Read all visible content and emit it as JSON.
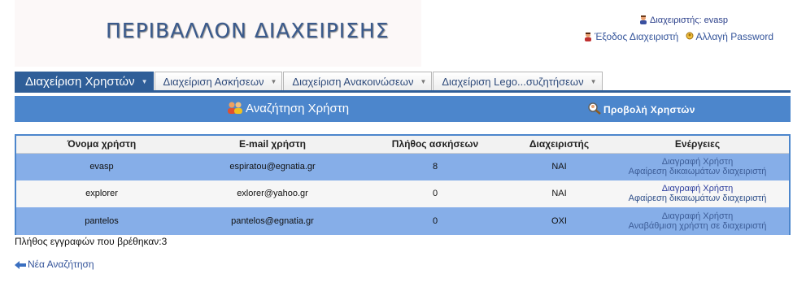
{
  "header": {
    "app_title": "ΠΕΡΙΒΑΛΛΟΝ ΔΙΑΧΕΙΡΙΣΗΣ",
    "admin_label": "Διαχειριστής:",
    "admin_name": "evasp",
    "logout_label": "Έξοδος Διαχειριστή",
    "change_password_label": "Αλλαγή Password"
  },
  "tabs": [
    {
      "label": "Διαχείριση Χρηστών",
      "active": true
    },
    {
      "label": "Διαχείριση Ασκήσεων",
      "active": false
    },
    {
      "label": "Διαχείριση Ανακοινώσεων",
      "active": false
    },
    {
      "label": "Διαχείριση Lego...συζητήσεων",
      "active": false
    }
  ],
  "actions": {
    "search_user": "Αναζήτηση Χρήστη",
    "view_users": "Προβολή Χρηστών"
  },
  "table": {
    "headers": [
      "Όνομα χρήστη",
      "E-mail χρήστη",
      "Πλήθος ασκήσεων",
      "Διαχειριστής",
      "Ενέργειες"
    ],
    "rows": [
      {
        "username": "evasp",
        "email": "espiratou@egnatia.gr",
        "exercises": "8",
        "admin": "ΝΑΙ",
        "action_delete": "Διαγραφή Χρήστη",
        "action_role": "Αφαίρεση δικαιωμάτων διαχειριστή"
      },
      {
        "username": "explorer",
        "email": "exlorer@yahoo.gr",
        "exercises": "0",
        "admin": "ΝΑΙ",
        "action_delete": "Διαγραφή Χρήστη",
        "action_role": "Αφαίρεση δικαιωμάτων διαχειριστή"
      },
      {
        "username": "pantelos",
        "email": "pantelos@egnatia.gr",
        "exercises": "0",
        "admin": "ΟΧΙ",
        "action_delete": "Διαγραφή Χρήστη",
        "action_role": "Αναβάθμιση χρήστη σε διαχειριστή"
      }
    ]
  },
  "footer": {
    "records_found": "Πλήθος εγγραφών που βρέθηκαν:3",
    "new_search": "Νέα Αναζήτηση"
  },
  "icons": {
    "admin": "admin-user-icon",
    "logout": "logout-icon",
    "password": "key-user-icon",
    "search_users": "users-icon",
    "view_users": "magnifier-user-icon",
    "back": "back-arrow-icon"
  },
  "colors": {
    "accent": "#2f5e98",
    "action_bar": "#4c86cc",
    "row_highlight": "#86aee8",
    "link": "#34549a"
  }
}
